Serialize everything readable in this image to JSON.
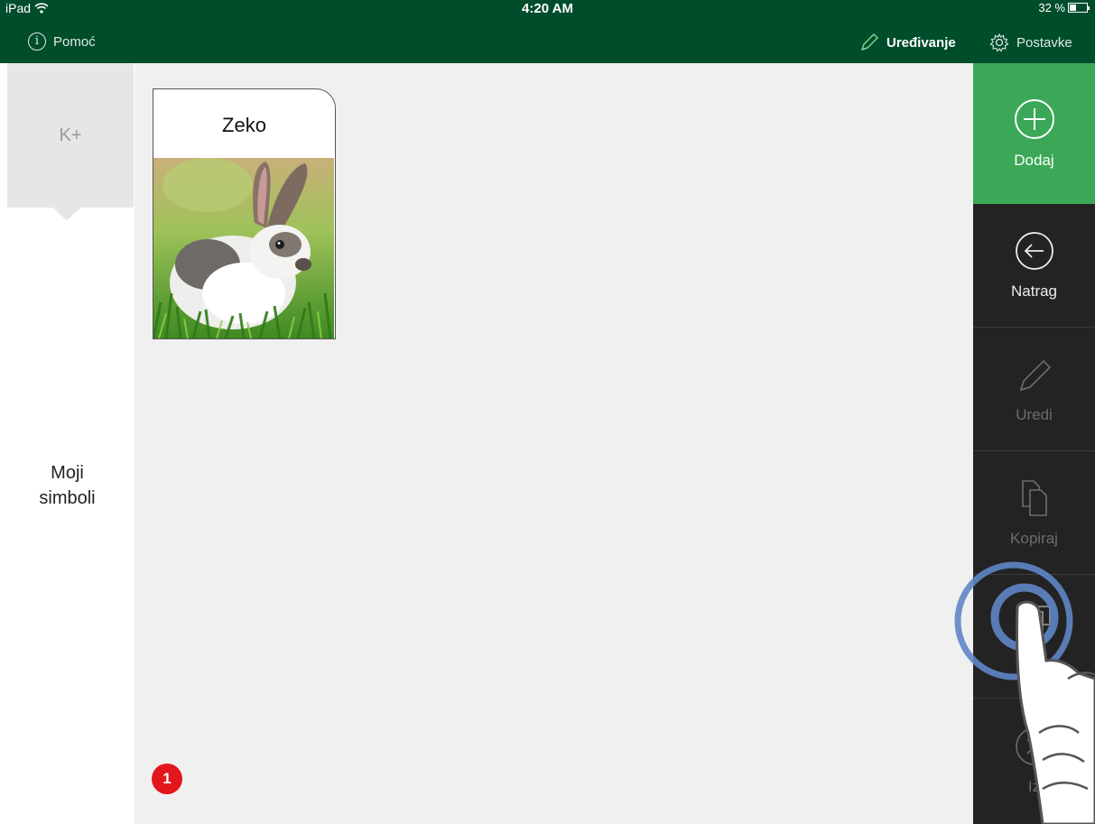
{
  "status_bar": {
    "device": "iPad",
    "time": "4:20 AM",
    "battery": "32 %"
  },
  "header": {
    "help_label": "Pomoć",
    "edit_mode_label": "Uređivanje",
    "settings_label": "Postavke"
  },
  "sidebar": {
    "tab_label": "K+",
    "category_label": "Moji\nsimboli"
  },
  "content": {
    "cards": [
      {
        "title": "Zeko",
        "image": "rabbit-photo"
      }
    ],
    "badge_count": "1"
  },
  "actions": {
    "add": {
      "label": "Dodaj",
      "icon": "plus-circle-icon"
    },
    "back": {
      "label": "Natrag",
      "icon": "arrow-left-circle-icon"
    },
    "edit": {
      "label": "Uredi",
      "icon": "pencil-icon"
    },
    "copy": {
      "label": "Kopiraj",
      "icon": "copy-icon"
    },
    "mark": {
      "label": "Ozn",
      "icon": "select-icon"
    },
    "delete": {
      "label": "Iz",
      "icon": "x-circle-icon"
    }
  },
  "colors": {
    "header_bg": "#004d2c",
    "add_green": "#3aa857",
    "panel_dark": "#232323",
    "badge_red": "#e3161b"
  }
}
